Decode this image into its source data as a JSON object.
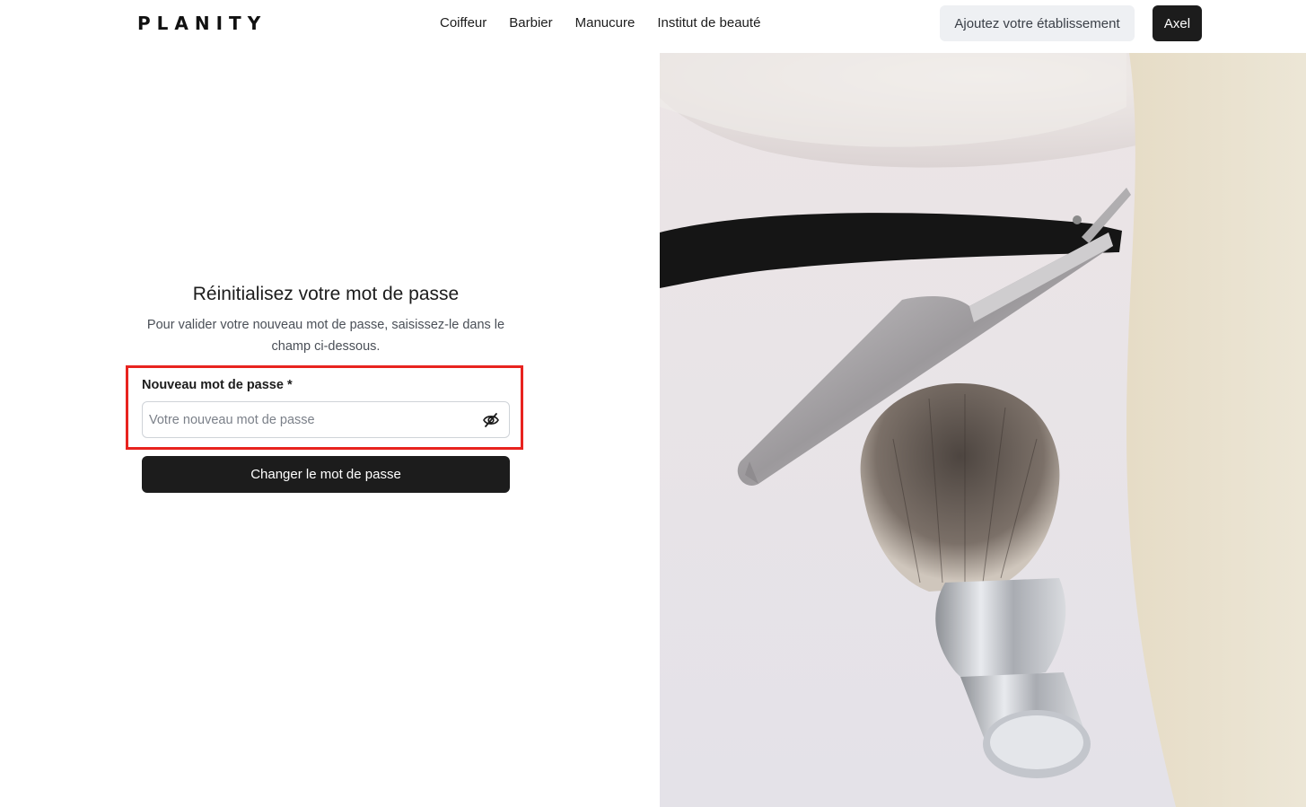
{
  "header": {
    "logo": "PLANITY",
    "nav": [
      "Coiffeur",
      "Barbier",
      "Manucure",
      "Institut de beauté"
    ],
    "add_business": "Ajoutez votre établissement",
    "user": "Axel"
  },
  "form": {
    "title": "Réinitialisez votre mot de passe",
    "subtitle": "Pour valider votre nouveau mot de passe, saisissez-le dans le champ ci-dessous.",
    "field_label": "Nouveau mot de passe *",
    "placeholder": "Votre nouveau mot de passe",
    "value": "",
    "toggle_icon": "eye-slash-icon",
    "submit": "Changer le mot de passe"
  },
  "hero_image": {
    "subject": "shaving-brush-and-straight-razor",
    "colors": {
      "background": "#e9e6ea",
      "panel": "#ebe4d3",
      "handle": "#151515",
      "blade": "#b8b6b8",
      "bristles": "#6e6660",
      "chrome": "#c9cbd0"
    }
  },
  "colors": {
    "accent": "#1c1c1c",
    "highlight": "#e8231f",
    "secondary_button": "#eef0f3"
  }
}
